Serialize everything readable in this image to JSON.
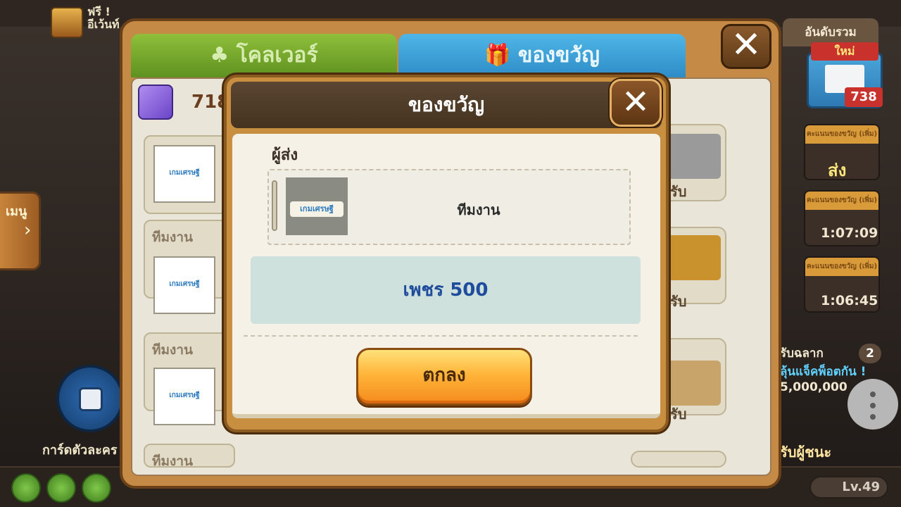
{
  "background": {
    "free_label": "ฟรี !",
    "free_sublabel": "อีเว้นท์",
    "menu_label": "เมนู",
    "card_label": "การ์ดตัวละคร",
    "level_label": "Lv.49",
    "ranking_tab": "อันดับรวม",
    "mail_new": "ใหม่",
    "mail_count": "738",
    "slots": [
      {
        "head": "คะแนนของขวัญ (เพิ่ม)",
        "value": "ส่ง"
      },
      {
        "head": "คะแนนของขวัญ (เพิ่ม)",
        "value": "1:07:09"
      },
      {
        "head": "คะแนนของขวัญ (เพิ่ม)",
        "value": "1:06:45"
      }
    ],
    "lottery_label": "รับฉลาก",
    "key_count": "2",
    "jackpot_label": "ลุ้นแจ็คพ็อตกัน !",
    "jackpot_amount": "5,000,000",
    "winner_label": "รับผู้ชนะ"
  },
  "gift_panel": {
    "tabs": [
      {
        "label": "♣ โคลเวอร์",
        "active": false
      },
      {
        "label": "🎁 ของขวัญ",
        "active": true
      }
    ],
    "gift_count": "718",
    "rows": [
      {
        "sender": "",
        "logo": "เกมเศรษฐี"
      },
      {
        "sender": "ทีมงาน",
        "logo": "เกมเศรษฐี"
      },
      {
        "sender": "ทีมงาน",
        "logo": "เกมเศรษฐี"
      },
      {
        "sender": "ทีมงาน",
        "logo": ""
      }
    ],
    "receive_label": "รับ"
  },
  "dialog": {
    "title": "ของขวัญ",
    "sender_label": "ผู้ส่ง",
    "sender_logo": "เกมเศรษฐี",
    "sender_name": "ทีมงาน",
    "reward": "เพชร 500",
    "ok_label": "ตกลง"
  },
  "colors": {
    "accent_orange": "#f48a1c",
    "reward_text": "#1f4c9c",
    "tab_active": "#2e8cc7",
    "tab_inactive": "#5e9120"
  }
}
